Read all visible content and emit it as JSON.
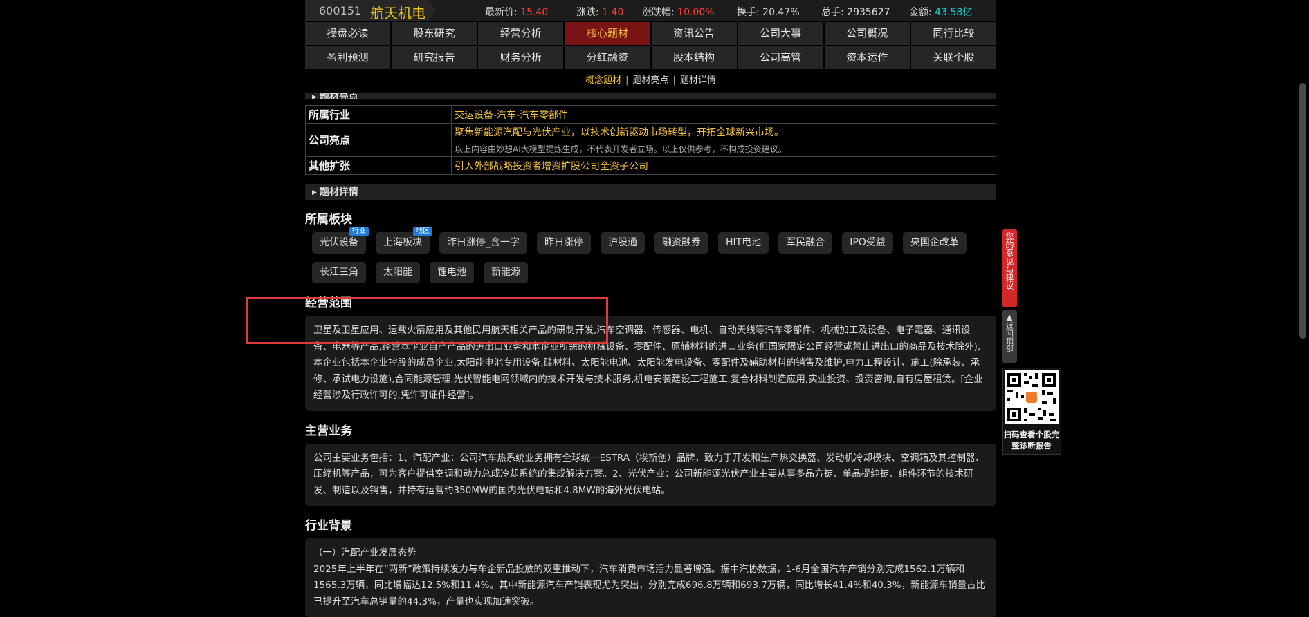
{
  "stock": {
    "code": "600151",
    "name": "航天机电",
    "price_label": "最新价:",
    "price": "15.40",
    "change_label": "涨跌:",
    "change": "1.40",
    "change_pct_label": "涨跌幅:",
    "change_pct": "10.00%",
    "turnover_label": "换手:",
    "turnover": "20.47%",
    "volume_label": "总手:",
    "volume": "2935627",
    "amount_label": "金额:",
    "amount": "43.58亿"
  },
  "nav": {
    "row1": [
      "操盘必读",
      "股东研究",
      "经营分析",
      "核心题材",
      "资讯公告",
      "公司大事",
      "公司概况",
      "同行比较"
    ],
    "row2": [
      "盈利预测",
      "研究报告",
      "财务分析",
      "分红融资",
      "股本结构",
      "公司高管",
      "资本运作",
      "关联个股"
    ],
    "active": "核心题材"
  },
  "sub_tabs": [
    "概念题材",
    "题材亮点",
    "题材详情"
  ],
  "highlights": {
    "section_title": "题材亮点",
    "rows": [
      {
        "key": "所属行业",
        "value": "交运设备-汽车-汽车零部件"
      },
      {
        "key": "公司亮点",
        "value": "聚焦新能源汽配与光伏产业，以技术创新驱动市场转型，开拓全球新兴市场。",
        "note": "以上内容由妙想AI大模型提炼生成，不代表开发者立场。以上仅供参考，不构成投资建议。"
      },
      {
        "key": "其他扩张",
        "value": "引入外部战略投资者增资扩股公司全资子公司"
      }
    ]
  },
  "details_title": "题材详情",
  "sectors": {
    "title": "所属板块",
    "tags": [
      {
        "label": "光伏设备",
        "badge": "行业"
      },
      {
        "label": "上海板块",
        "badge": "地区"
      },
      {
        "label": "昨日涨停_含一字"
      },
      {
        "label": "昨日涨停"
      },
      {
        "label": "沪股通"
      },
      {
        "label": "融资融券"
      },
      {
        "label": "HIT电池"
      },
      {
        "label": "军民融合"
      },
      {
        "label": "IPO受益"
      },
      {
        "label": "央国企改革"
      },
      {
        "label": "长江三角"
      },
      {
        "label": "太阳能"
      },
      {
        "label": "锂电池"
      },
      {
        "label": "新能源"
      }
    ]
  },
  "business_scope": {
    "title": "经营范围",
    "text": "卫星及卫星应用、运载火箭应用及其他民用航天相关产品的研制开发,汽车空调器、传感器、电机、自动天线等汽车零部件、机械加工及设备、电子電器、通讯设备、电器等产品,经营本企业自产产品的进出口业务和本企业所需的机械设备、零配件、原辅材料的进口业务(但国家限定公司经营或禁止进出口的商品及技术除外),本企业包括本企业控股的成员企业,太阳能电池专用设备,硅材料、太阳能电池、太阳能发电设备、零配件及辅助材料的销售及维护,电力工程设计、施工(除承装、承修、承试电力设施),合同能源管理,光伏智能电网领域内的技术开发与技术服务,机电安装建设工程施工,复合材料制造应用,实业投资、投资咨询,自有房屋租赁。[企业经营涉及行政许可的,凭许可证件经营]。"
  },
  "main_business": {
    "title": "主营业务",
    "text": "公司主要业务包括：1、汽配产业：公司汽车热系统业务拥有全球统一ESTRA（埃斯创）品牌，致力于开发和生产热交换器、发动机冷却模块、空调箱及其控制器、压缩机等产品，可为客户提供空调和动力总成冷却系统的集成解决方案。2、光伏产业：公司新能源光伏产业主要从事多晶方锭、单晶提纯锭、组件环节的技术研发、制造以及销售，并持有运营约350MW的国内光伏电站和4.8MW的海外光伏电站。"
  },
  "industry_bg": {
    "title": "行业背景",
    "subtitle": "（一）汽配产业发展态势",
    "text": "2025年上半年在“两新”政策持续发力与车企新品投放的双重推动下，汽车消费市场活力显著增强。据中汽协数据，1-6月全国汽车产销分别完成1562.1万辆和1565.3万辆，同比增幅达12.5%和11.4%。其中新能源汽车产销表现尤为突出，分别完成696.8万辆和693.7万辆，同比增长41.4%和40.3%，新能源车销量占比已提升至汽车总销量的44.3%，产量也实现加速突破。"
  },
  "widgets": {
    "feedback": "您的意见与建议",
    "back_top": "返回顶部",
    "qr_label": "扫码查看个股完整诊断报告"
  }
}
